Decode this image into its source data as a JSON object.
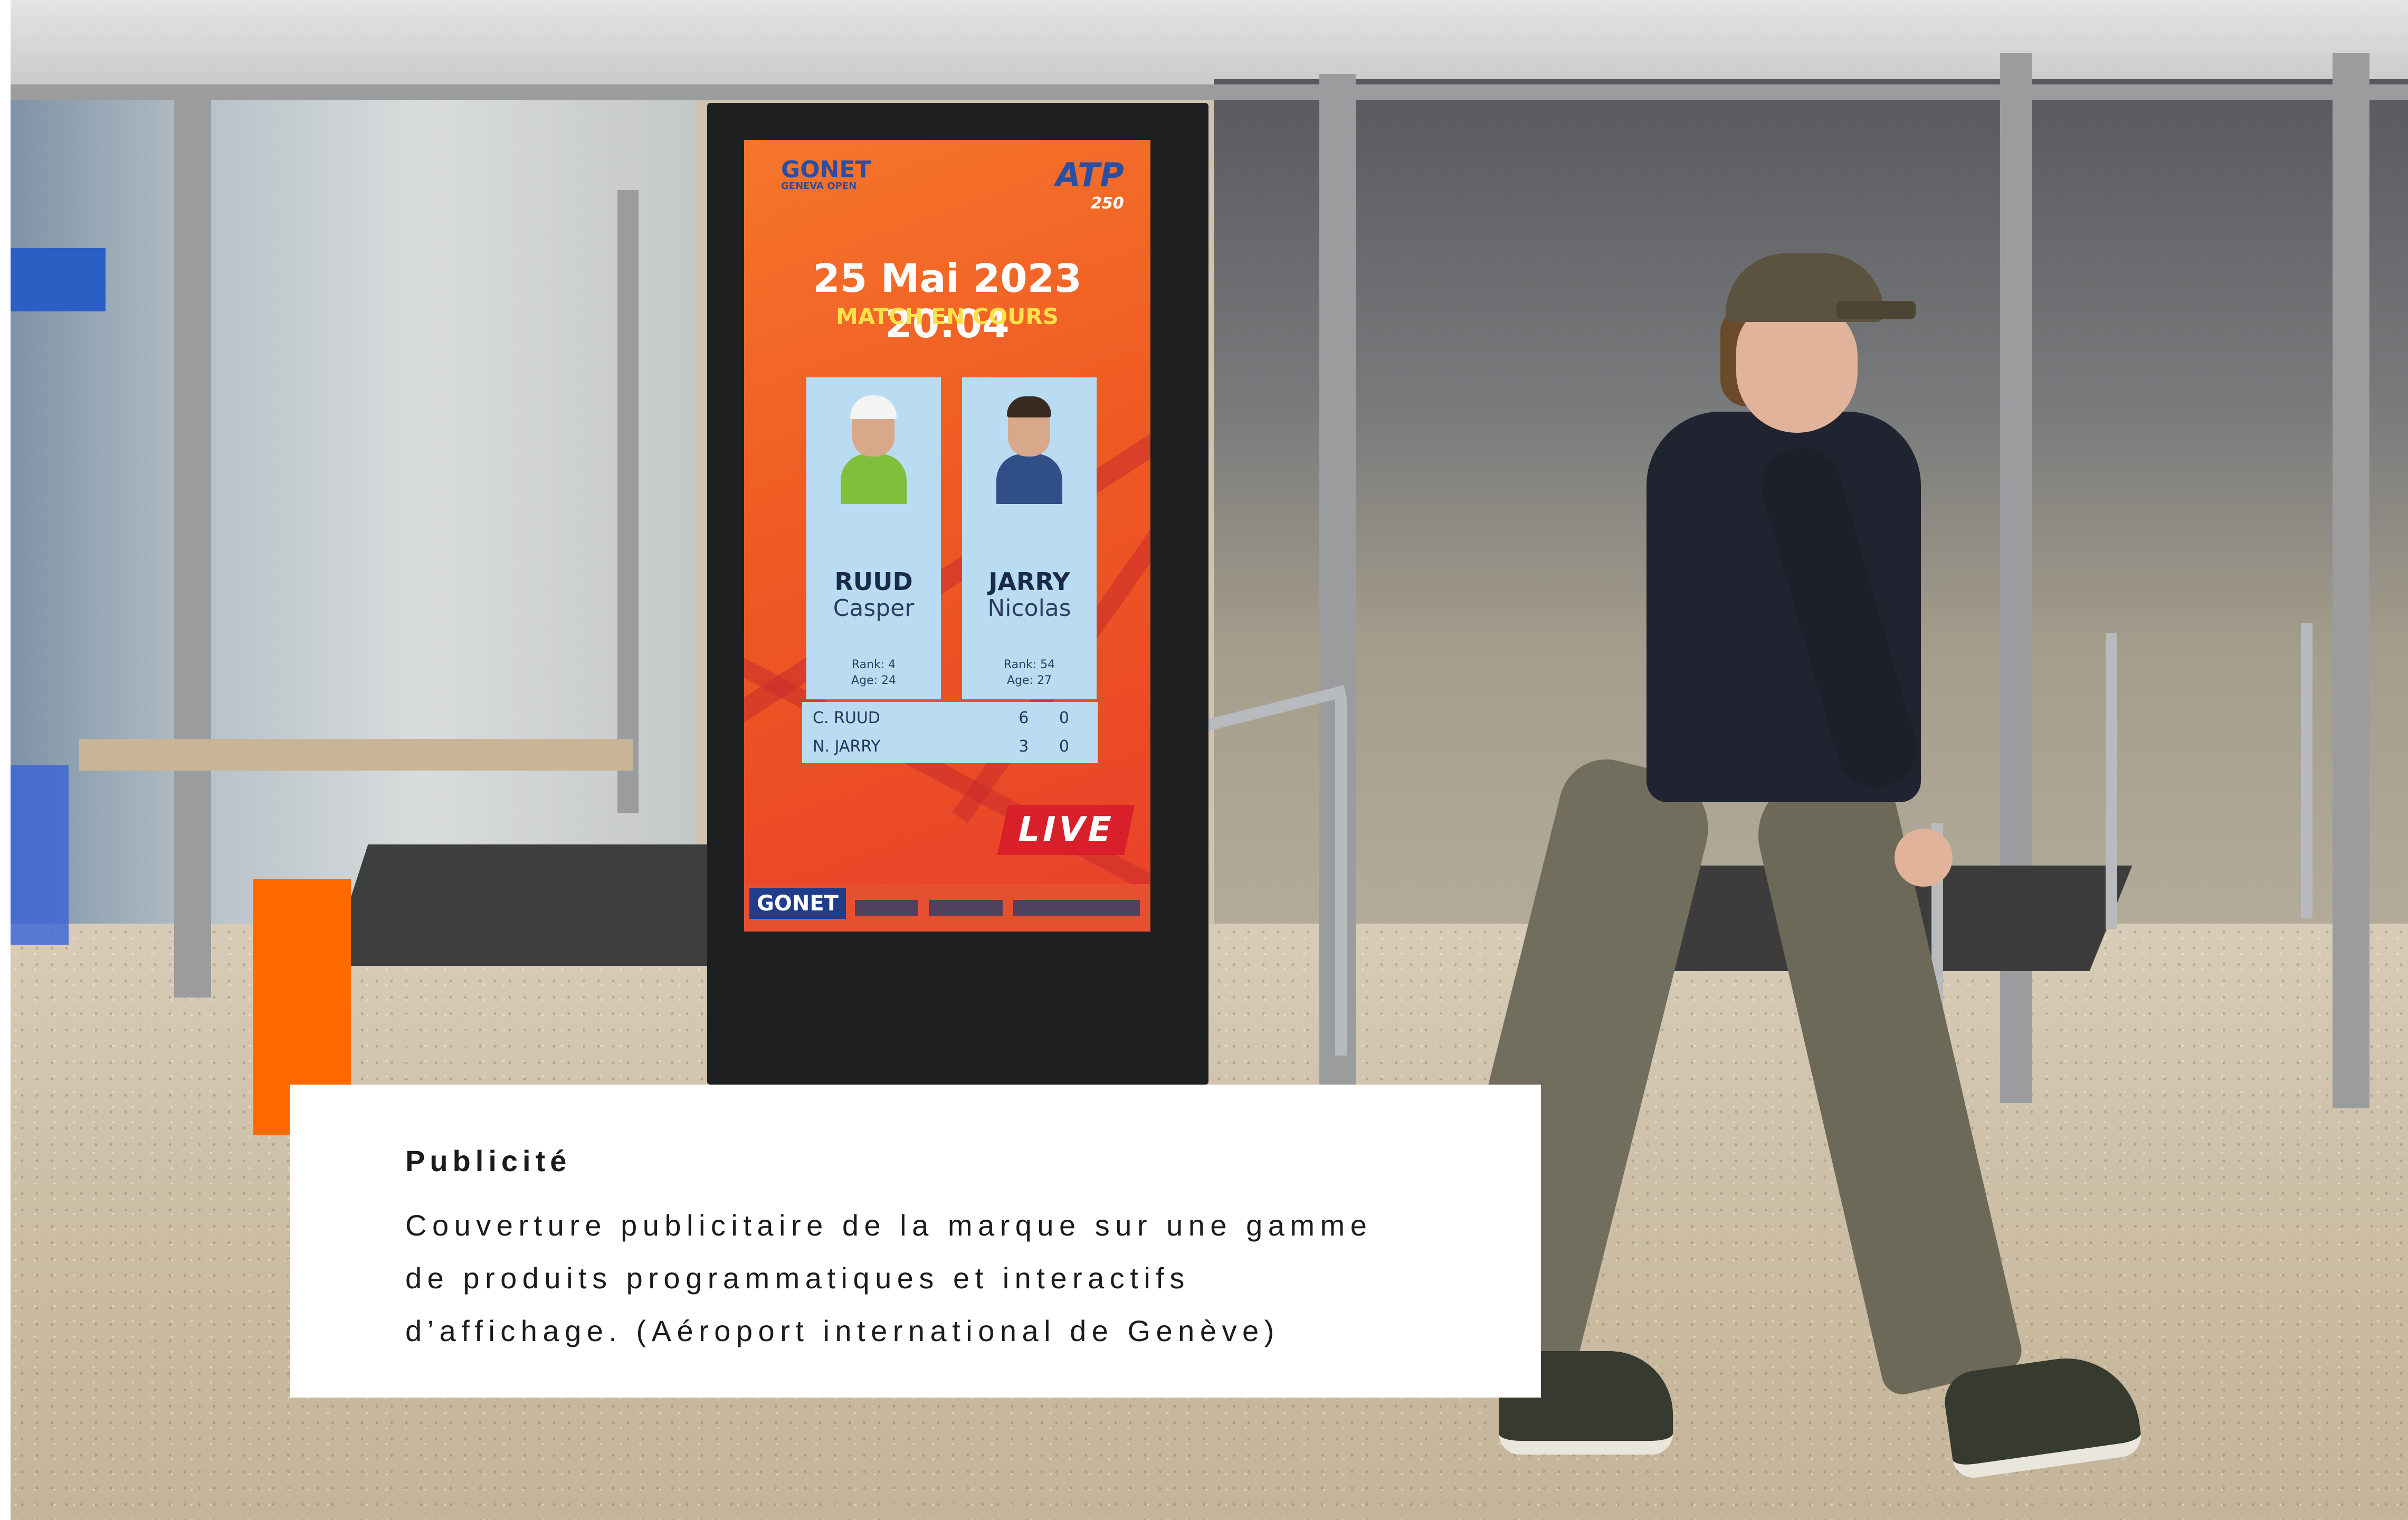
{
  "caption": {
    "title": "Publicité",
    "body_lines": [
      "Couverture publicitaire de la marque sur une gamme",
      "de produits programmatiques et interactifs",
      "d’affichage. (Aéroport international de Genève)"
    ]
  },
  "screen": {
    "brand": "GONET",
    "brand_sub": "GENEVA OPEN",
    "tour": "ATP",
    "tour_level": "250",
    "datetime": "25 Mai 2023 20:04",
    "status": "MATCH EN COURS",
    "players": [
      {
        "surname": "RUUD",
        "first_name": "Casper",
        "rank": "Rank: 4",
        "age": "Age: 24"
      },
      {
        "surname": "JARRY",
        "first_name": "Nicolas",
        "rank": "Rank: 54",
        "age": "Age: 27"
      }
    ],
    "scoreboard": [
      {
        "name": "C. RUUD",
        "games": "6 0"
      },
      {
        "name": "N. JARRY",
        "games": "3 0"
      }
    ],
    "live_label": "LIVE"
  },
  "colors": {
    "accent": "#ff6a00",
    "caption_bg": "#ffffff",
    "screen_orange": "#f26a2a",
    "live_red": "#d81f2a"
  }
}
